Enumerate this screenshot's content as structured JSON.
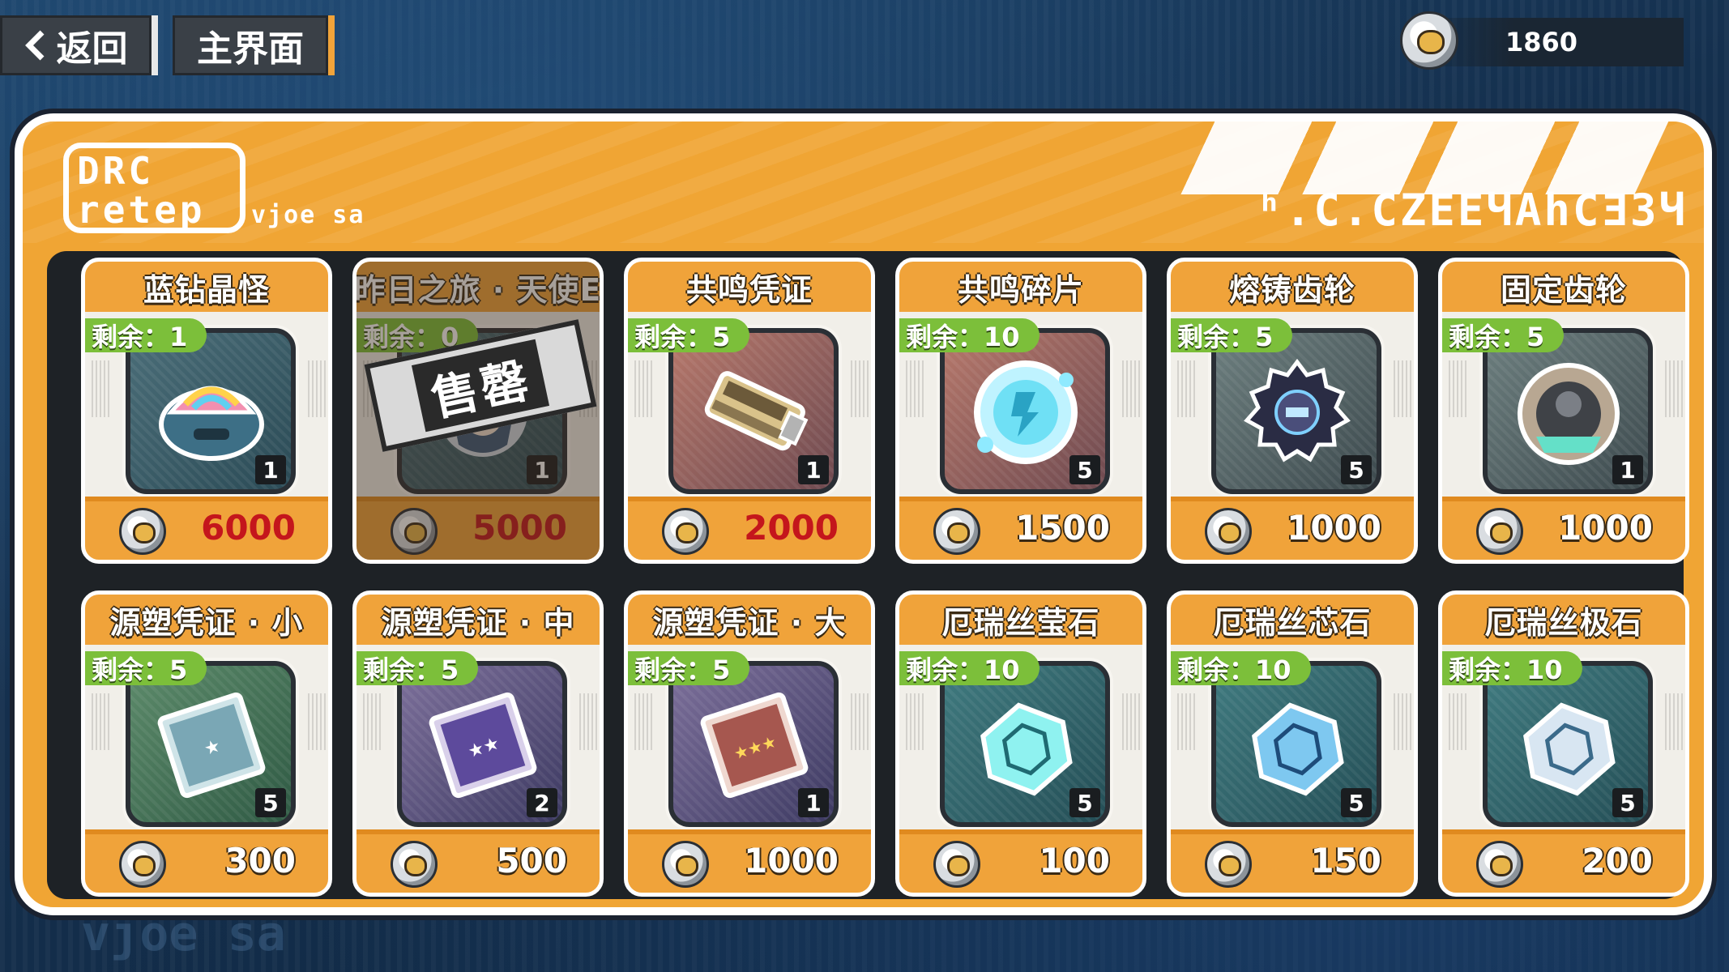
{
  "nav": {
    "back_label": "返回",
    "home_label": "主界面"
  },
  "currency": {
    "amount": "1860",
    "icon": "coin-icon"
  },
  "panel": {
    "logo_text_1": "DRC",
    "logo_text_2": "retep",
    "logo_sub": "vjoe sa",
    "deco_text": "ʰ.C.CZEEЧAhCƎЗЧ"
  },
  "items": [
    {
      "name": "蓝钻晶怪",
      "stock_label": "剩余：1",
      "qty": "1",
      "price": "6000",
      "price_style": "red",
      "frame": "bg-blue",
      "icon": "blue-crystal-monster-icon",
      "sold_out": false
    },
    {
      "name": "昨日之旅 · 天使E",
      "stock_label": "剩余：0",
      "qty": "1",
      "price": "5000",
      "price_style": "red",
      "frame": "bg-blue",
      "icon": "angel-portrait-icon",
      "sold_out": true,
      "sold_out_label": "售罄"
    },
    {
      "name": "共鸣凭证",
      "stock_label": "剩余：5",
      "qty": "1",
      "price": "2000",
      "price_style": "red",
      "frame": "bg-red",
      "icon": "usb-drive-icon",
      "sold_out": false
    },
    {
      "name": "共鸣碎片",
      "stock_label": "剩余：10",
      "qty": "5",
      "price": "1500",
      "price_style": "white",
      "frame": "bg-red",
      "icon": "crystal-shard-icon",
      "sold_out": false
    },
    {
      "name": "熔铸齿轮",
      "stock_label": "剩余：5",
      "qty": "5",
      "price": "1000",
      "price_style": "white",
      "frame": "bg-gray",
      "icon": "dark-gear-icon",
      "sold_out": false
    },
    {
      "name": "固定齿轮",
      "stock_label": "剩余：5",
      "qty": "1",
      "price": "1000",
      "price_style": "white",
      "frame": "bg-gray",
      "icon": "metal-gear-icon",
      "sold_out": false
    },
    {
      "name": "源塑凭证 · 小",
      "stock_label": "剩余：5",
      "qty": "5",
      "price": "300",
      "price_style": "white",
      "frame": "bg-green",
      "icon": "ticket-blue-icon",
      "sold_out": false
    },
    {
      "name": "源塑凭证 · 中",
      "stock_label": "剩余：5",
      "qty": "2",
      "price": "500",
      "price_style": "white",
      "frame": "bg-purple",
      "icon": "ticket-purple-icon",
      "sold_out": false
    },
    {
      "name": "源塑凭证 · 大",
      "stock_label": "剩余：5",
      "qty": "1",
      "price": "1000",
      "price_style": "white",
      "frame": "bg-purple",
      "icon": "ticket-red-icon",
      "sold_out": false
    },
    {
      "name": "厄瑞丝莹石",
      "stock_label": "剩余：10",
      "qty": "5",
      "price": "100",
      "price_style": "white",
      "frame": "bg-teal",
      "icon": "stone-cyan-icon",
      "sold_out": false
    },
    {
      "name": "厄瑞丝芯石",
      "stock_label": "剩余：10",
      "qty": "5",
      "price": "150",
      "price_style": "white",
      "frame": "bg-teal",
      "icon": "stone-blue-icon",
      "sold_out": false
    },
    {
      "name": "厄瑞丝极石",
      "stock_label": "剩余：10",
      "qty": "5",
      "price": "200",
      "price_style": "white",
      "frame": "bg-teal",
      "icon": "stone-silver-icon",
      "sold_out": false
    }
  ],
  "colors": {
    "panel_orange": "#f0a534",
    "stock_green": "#7cbf3a",
    "price_red": "#c4161c"
  }
}
